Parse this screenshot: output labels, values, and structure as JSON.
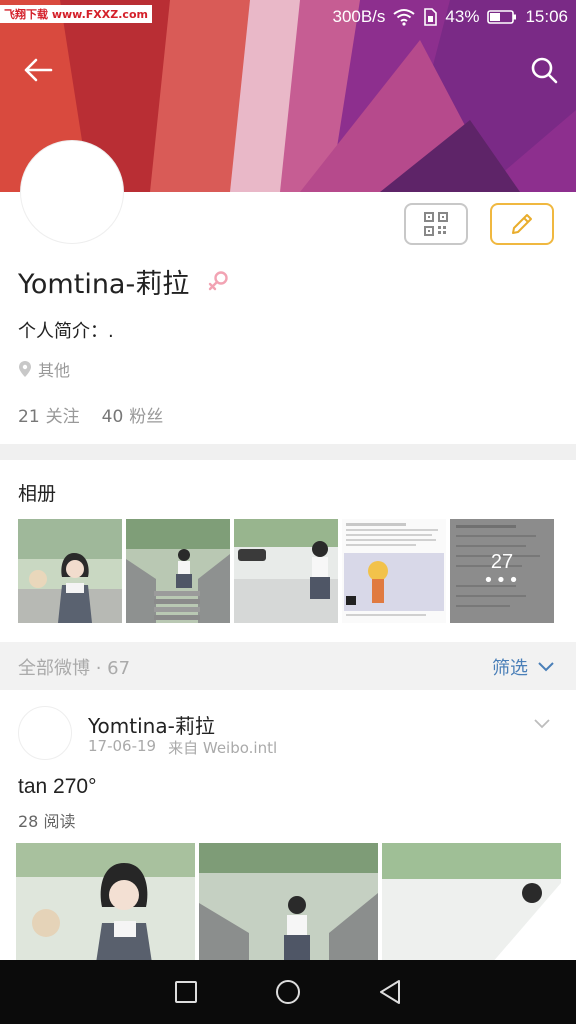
{
  "watermark": "飞翔下载 www.FXXZ.com",
  "status": {
    "speed": "300B/s",
    "battery": "43%",
    "time": "15:06"
  },
  "profile": {
    "username": "Yomtina-莉拉",
    "bio": "个人简介：.",
    "location": "其他",
    "following_count": "21",
    "following_label": "关注",
    "followers_count": "40",
    "followers_label": "粉丝"
  },
  "album": {
    "title": "相册",
    "photo_count": "27",
    "more": "•••"
  },
  "feed": {
    "label": "全部微博 · 67",
    "filter_label": "筛选"
  },
  "post": {
    "author": "Yomtina-莉拉",
    "date": "17-06-19",
    "source": "来自 Weibo.intl",
    "text": "tan 270°",
    "reads": "28 阅读"
  },
  "colors": {
    "accent_edit": "#f0b840",
    "link_blue": "#4a7fb8",
    "banner_red": "#d13b3a",
    "banner_purple": "#8b2e8f"
  },
  "icons": [
    "back-arrow-icon",
    "search-icon",
    "qr-code-icon",
    "pencil-icon",
    "female-icon",
    "location-pin-icon",
    "chevron-down-icon",
    "square-nav-icon",
    "circle-nav-icon",
    "triangle-nav-icon",
    "wifi-icon",
    "battery-icon"
  ]
}
